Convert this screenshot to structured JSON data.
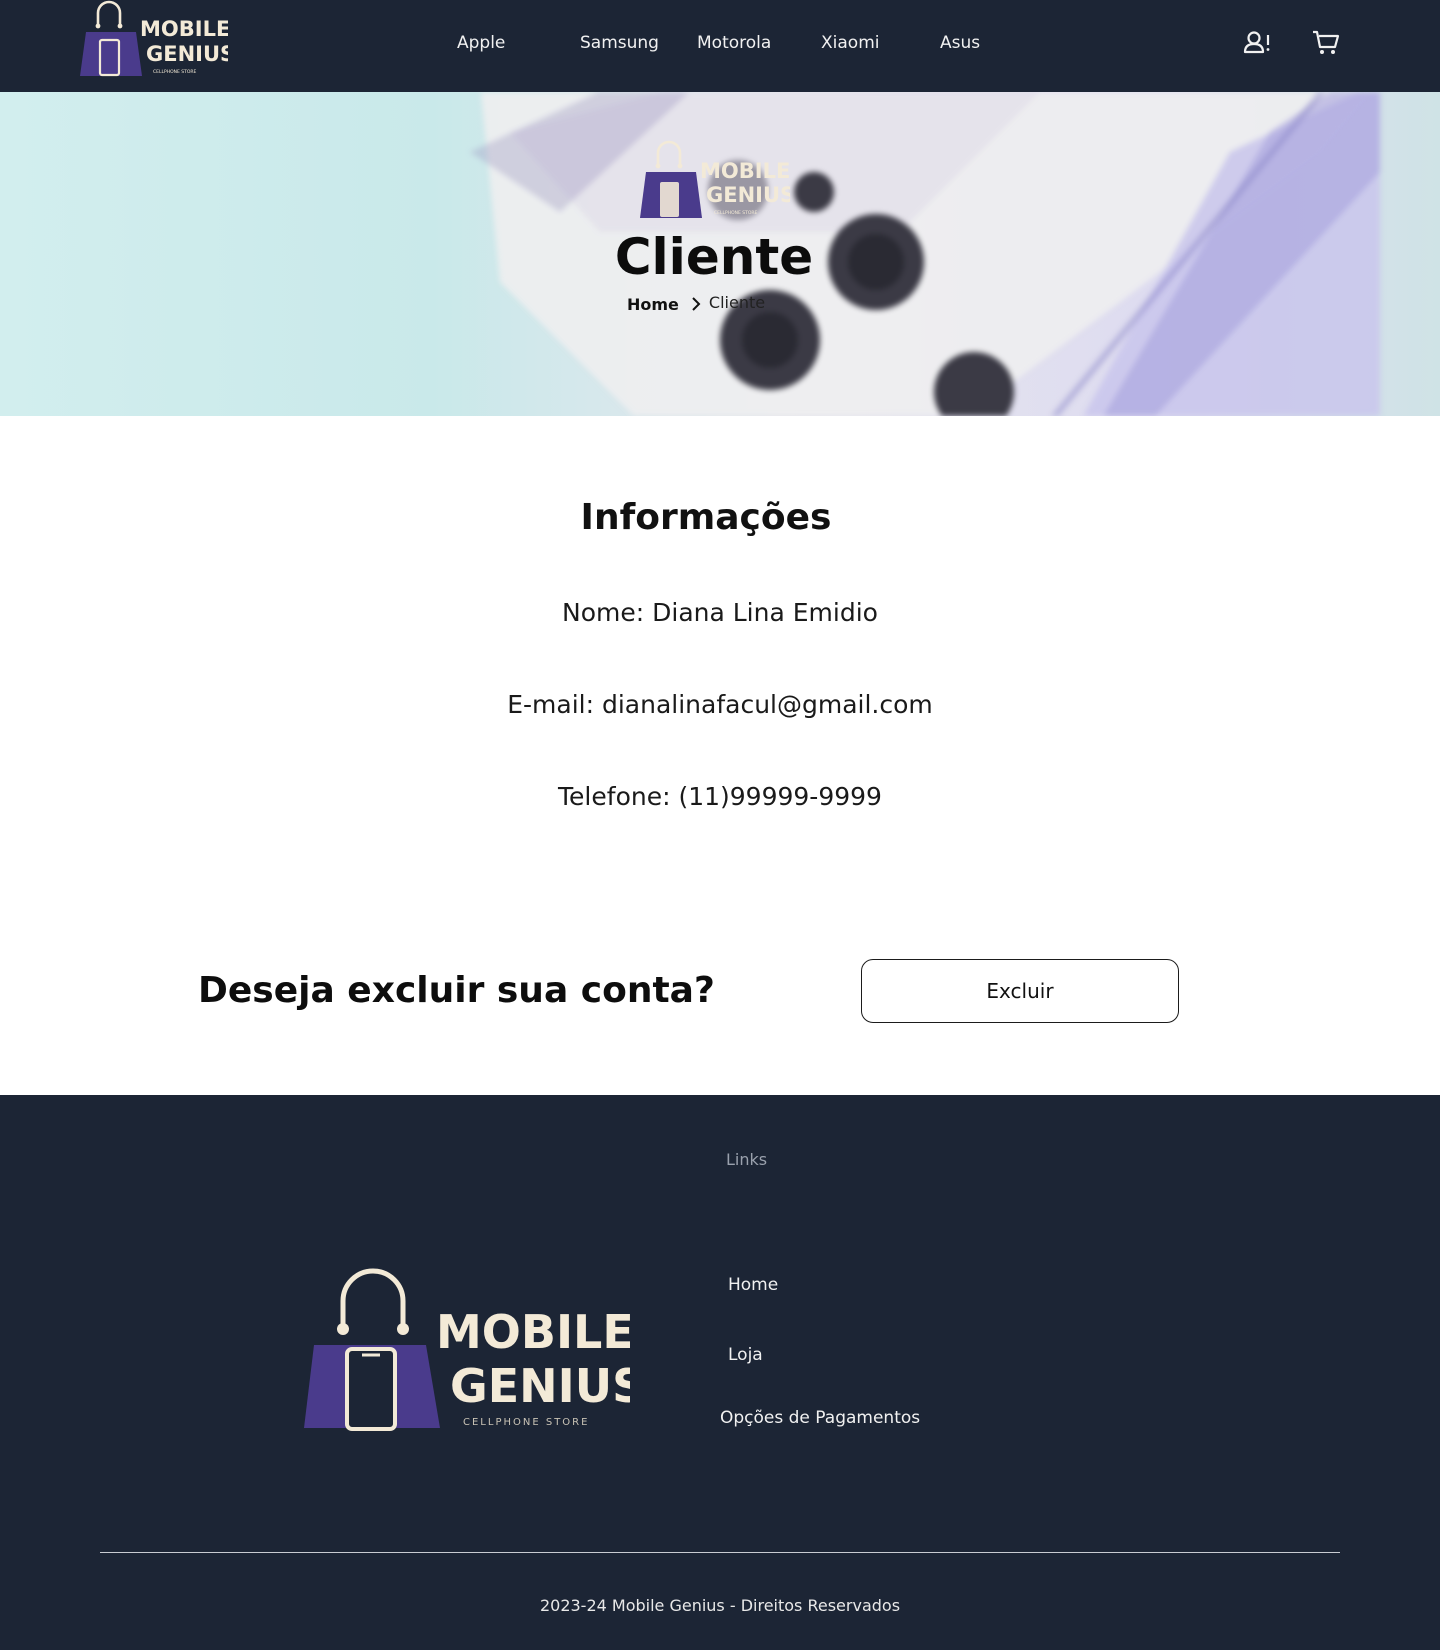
{
  "brand": {
    "name_line1": "MOBILE",
    "name_line2": "GENIUS",
    "tagline": "CELLPHONE STORE"
  },
  "nav": {
    "links": [
      "Apple",
      "Samsung",
      "Motorola",
      "Xiaomi",
      "Asus"
    ],
    "icons": [
      "user-alert-icon",
      "cart-icon"
    ]
  },
  "hero": {
    "title": "Cliente",
    "breadcrumb": {
      "home": "Home",
      "current": "Cliente"
    }
  },
  "info": {
    "title": "Informações",
    "name_line": "Nome: Diana Lina Emidio",
    "email_line": "E-mail: dianalinafacul@gmail.com",
    "phone_line": "Telefone: (11)99999-9999"
  },
  "account": {
    "question": "Deseja excluir sua conta?",
    "delete_label": "Excluir"
  },
  "footer": {
    "links_heading": "Links",
    "links": [
      "Home",
      "Loja",
      "Opções de Pagamentos"
    ],
    "copyright": "2023-24 Mobile Genius - Direitos Reservados"
  },
  "colors": {
    "navy": "#1c2535",
    "brand_purple": "#4a3b8c",
    "brand_cream": "#f3ead7"
  }
}
